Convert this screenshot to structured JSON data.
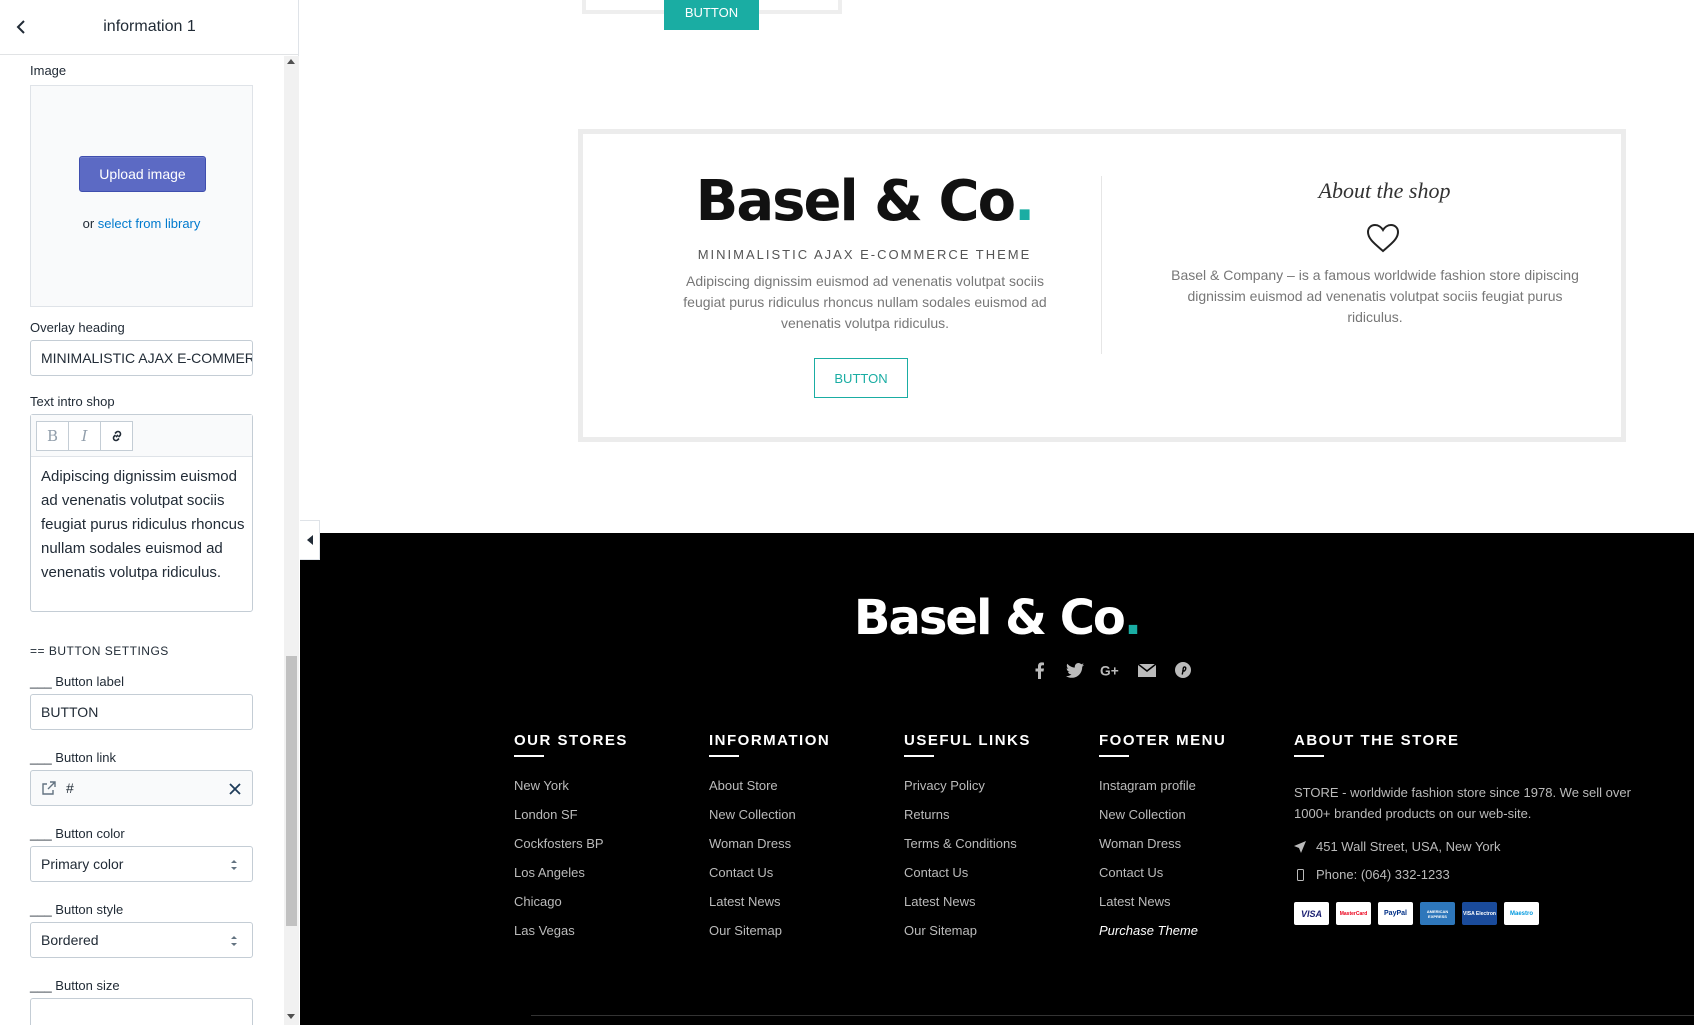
{
  "sidebar": {
    "title": "information 1",
    "image": {
      "label": "Image",
      "upload_button": "Upload image",
      "or_text": "or",
      "library_link": "select from library"
    },
    "overlay_heading": {
      "label": "Overlay heading",
      "value": "MINIMALISTIC AJAX E-COMMERCE THEME"
    },
    "text_intro": {
      "label": "Text intro shop",
      "bold": "B",
      "italic": "I",
      "value": "Adipiscing dignissim euismod ad venenatis volutpat sociis feugiat purus ridiculus rhoncus nullam sodales euismod ad venenatis volutpa ridiculus."
    },
    "button_settings": {
      "section_title": "== BUTTON SETTINGS",
      "label_label": "___ Button label",
      "label_value": "BUTTON",
      "link_label": "___ Button link",
      "link_value": "#",
      "color_label": "___ Button color",
      "color_value": "Primary color",
      "style_label": "___ Button style",
      "style_value": "Bordered",
      "size_label": "___ Button size"
    }
  },
  "preview": {
    "top_button": "BUTTON",
    "brand": {
      "name": "Basel & Co",
      "dot": ".",
      "accent_color": "#1aada3"
    },
    "info": {
      "subtitle": "MINIMALISTIC AJAX E-COMMERCE THEME",
      "intro": "Adipiscing dignissim euismod ad venenatis volutpat sociis feugiat purus ridiculus rhoncus nullam sodales euismod ad venenatis volutpa ridiculus.",
      "button": "BUTTON",
      "about_title": "About the shop",
      "about_text": "Basel & Company – is a famous worldwide fashion store dipiscing dignissim euismod ad venenatis volutpat sociis feugiat purus ridiculus."
    },
    "footer": {
      "socials": [
        "facebook-icon",
        "twitter-icon",
        "google-plus-icon",
        "email-icon",
        "pinterest-icon"
      ],
      "columns": [
        {
          "title": "OUR STORES",
          "items": [
            "New York",
            "London SF",
            "Cockfosters BP",
            "Los Angeles",
            "Chicago",
            "Las Vegas"
          ]
        },
        {
          "title": "INFORMATION",
          "items": [
            "About Store",
            "New Collection",
            "Woman Dress",
            "Contact Us",
            "Latest News",
            "Our Sitemap"
          ]
        },
        {
          "title": "USEFUL LINKS",
          "items": [
            "Privacy Policy",
            "Returns",
            "Terms & Conditions",
            "Contact Us",
            "Latest News",
            "Our Sitemap"
          ]
        },
        {
          "title": "FOOTER MENU",
          "items": [
            "Instagram profile",
            "New Collection",
            "Woman Dress",
            "Contact Us",
            "Latest News",
            "Purchase Theme"
          ]
        }
      ],
      "about": {
        "title": "ABOUT THE STORE",
        "text": "STORE - worldwide fashion store since 1978. We sell over 1000+ branded products on our web-site.",
        "address": "451 Wall Street, USA, New York",
        "phone": "Phone: (064) 332-1233",
        "cards": [
          "VISA",
          "MasterCard",
          "PayPal",
          "AMERICAN EXPRESS",
          "VISA Electron",
          "Maestro"
        ]
      }
    }
  }
}
